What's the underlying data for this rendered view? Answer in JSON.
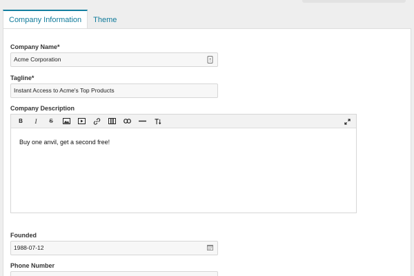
{
  "tabs": [
    {
      "label": "Company Information"
    },
    {
      "label": "Theme"
    }
  ],
  "form": {
    "company_name": {
      "label": "Company Name*",
      "value": "Acme Corporation"
    },
    "tagline": {
      "label": "Tagline*",
      "value": "Instant Access to Acme's Top Products"
    },
    "description": {
      "label": "Company Description",
      "value": "Buy one anvil, get a second free!"
    },
    "founded": {
      "label": "Founded",
      "value": "1988-07-12"
    },
    "phone": {
      "label": "Phone Number",
      "value": ""
    }
  },
  "toolbar": {
    "bold": "B",
    "italic": "I",
    "strike": "S"
  },
  "colors": {
    "accent": "#137fa0",
    "panel_bg": "#ffffff",
    "page_bg": "#eeeeee"
  }
}
